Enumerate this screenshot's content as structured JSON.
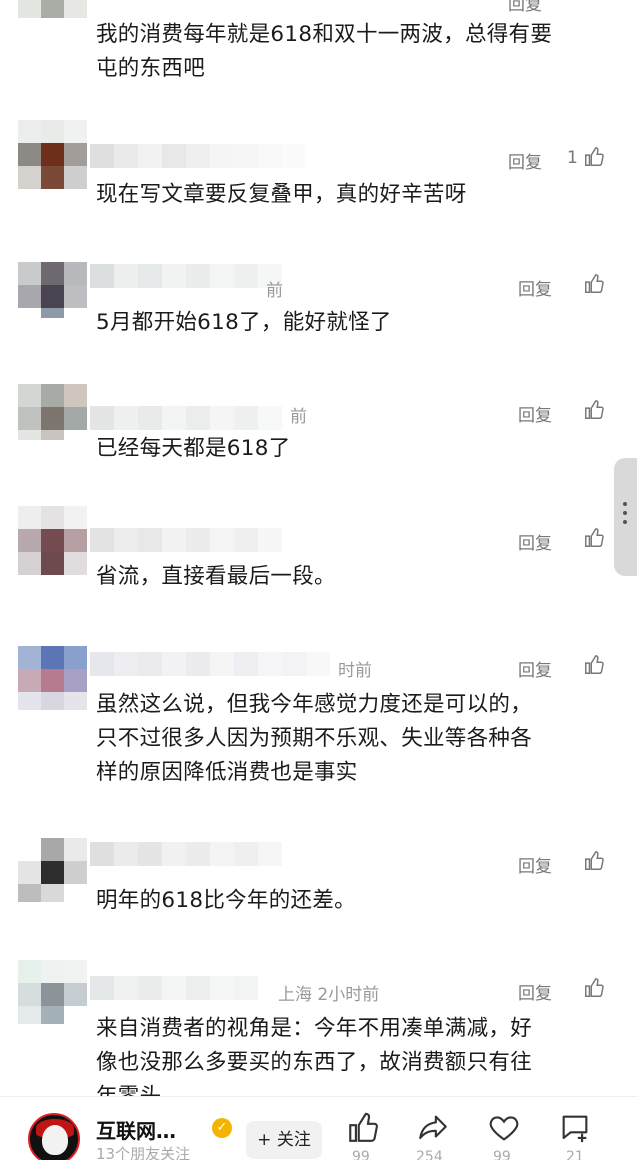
{
  "comments": [
    {
      "meta": "",
      "reply": "回复",
      "likes": "",
      "text": [
        "我的消费每年就是618和双十一两波，总得有要",
        "屯的东西吧"
      ]
    },
    {
      "meta": "",
      "reply": "回复",
      "likes": "1",
      "text": [
        "现在写文章要反复叠甲，真的好辛苦呀"
      ]
    },
    {
      "meta": "前",
      "reply": "回复",
      "likes": "",
      "text": [
        "5月都开始618了，能好就怪了"
      ]
    },
    {
      "meta": "前",
      "reply": "回复",
      "likes": "",
      "text": [
        "已经每天都是618了"
      ]
    },
    {
      "meta": "",
      "reply": "回复",
      "likes": "",
      "text": [
        "省流，直接看最后一段。"
      ]
    },
    {
      "meta": "时前",
      "reply": "回复",
      "likes": "",
      "text": [
        "虽然这么说，但我今年感觉力度还是可以的，",
        "只不过很多人因为预期不乐观、失业等各种各",
        "样的原因降低消费也是事实"
      ]
    },
    {
      "meta": "",
      "reply": "回复",
      "likes": "",
      "text": [
        "明年的618比今年的还差。"
      ]
    },
    {
      "meta": "上海 2小时前",
      "reply": "回复",
      "likes": "",
      "text": [
        "来自消费者的视角是：今年不用凑单满减，好",
        "像也没那么多要买的东西了，故消费额只有往",
        "年零头"
      ]
    }
  ],
  "bottom_bar": {
    "author_name": "互联网…",
    "author_sub": "13个朋友关注",
    "follow_label": "+ 关注",
    "counts": {
      "like": "99",
      "share": "254",
      "favorite": "99",
      "comment": "21"
    }
  },
  "icons": {
    "like": "thumbs-up-icon",
    "share": "share-arrow-icon",
    "favorite": "heart-icon",
    "comment": "comment-bubble-icon",
    "verify": "verified-badge-icon",
    "scroll": "more-vertical-icon"
  },
  "colors": {
    "text": "#1b1b1b",
    "muted": "#999999",
    "verify": "#f5b400",
    "accent": "#c01515"
  }
}
